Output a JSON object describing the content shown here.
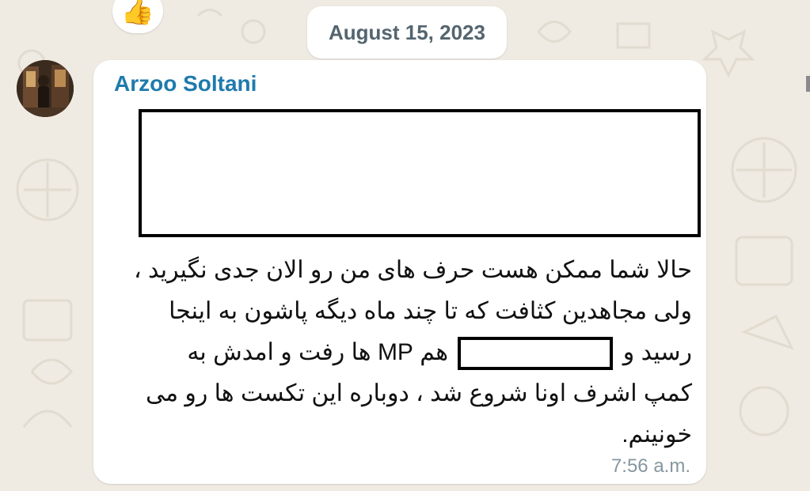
{
  "chat": {
    "date_separator": "August 15, 2023",
    "reaction_emoji": "👍",
    "message": {
      "sender": "Arzoo Soltani",
      "lines": [
        "حالا شما ممکن هست حرف های من رو الان جدی نگیرید ،",
        "ولی مجاهدین کثافت که تا چند ماه دیگه پاشون به اینجا",
        "رسید و",
        "هم MP ها رفت و امدش به",
        "کمپ اشرف اونا شروع شد ، دوباره این تکست ها رو می",
        "خونینم."
      ],
      "time": "7:56 a.m."
    }
  },
  "colors": {
    "background": "#efeae2",
    "bubble": "#ffffff",
    "sender_name": "#1f7aad",
    "timestamp": "#8696a0",
    "redaction_border": "#000000"
  },
  "icons": {
    "reaction": "thumbs-up-icon",
    "avatar": "user-avatar-photo"
  }
}
